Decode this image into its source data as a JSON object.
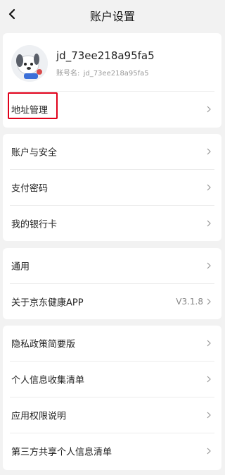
{
  "header": {
    "title": "账户设置"
  },
  "profile": {
    "username": "jd_73ee218a95fa5",
    "account_label": "账号名:",
    "account_value": "jd_73ee218a95fa5"
  },
  "groups": [
    {
      "items": [
        {
          "label": "地址管理"
        }
      ]
    },
    {
      "items": [
        {
          "label": "账户与安全"
        },
        {
          "label": "支付密码"
        },
        {
          "label": "我的银行卡"
        }
      ]
    },
    {
      "items": [
        {
          "label": "通用"
        },
        {
          "label": "关于京东健康APP",
          "value": "V3.1.8"
        }
      ]
    },
    {
      "items": [
        {
          "label": "隐私政策简要版"
        },
        {
          "label": "个人信息收集清单"
        },
        {
          "label": "应用权限说明"
        },
        {
          "label": "第三方共享个人信息清单"
        }
      ]
    }
  ],
  "colors": {
    "highlight": "#e0001a",
    "background": "#f2f2f2"
  }
}
